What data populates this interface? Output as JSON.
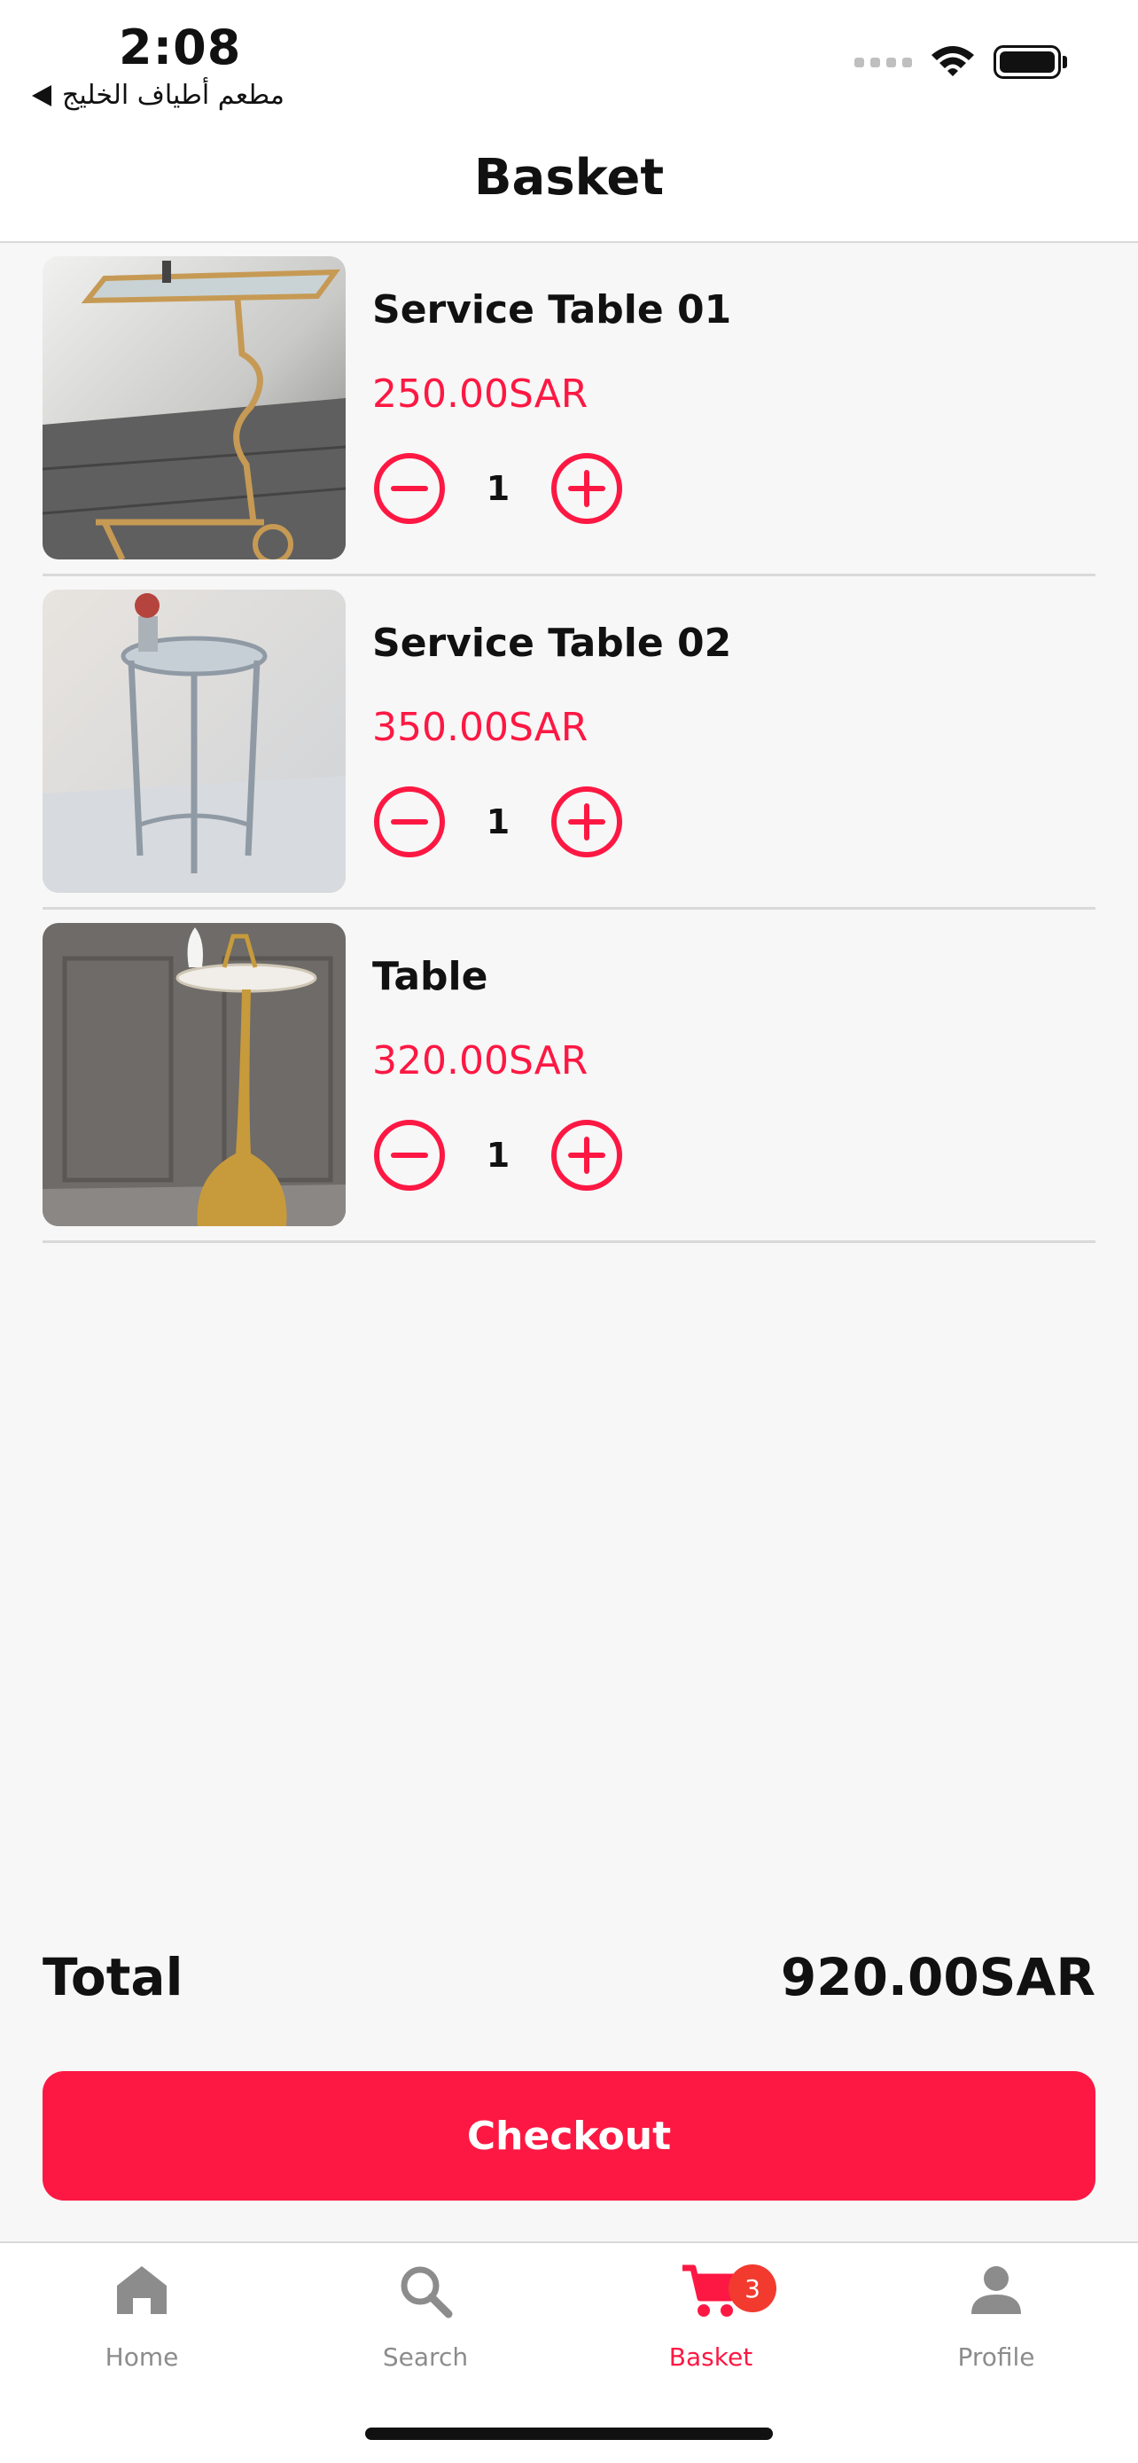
{
  "status_bar": {
    "time": "2:08",
    "back_app": "مطعم أطياف الخليج",
    "icons": [
      "signal-icon",
      "wifi-icon",
      "battery-icon"
    ]
  },
  "header": {
    "title": "Basket"
  },
  "items": [
    {
      "name": "Service Table 01",
      "price": "250.00SAR",
      "quantity": "1",
      "image": "gold-frame-side-table"
    },
    {
      "name": "Service Table 02",
      "price": "350.00SAR",
      "quantity": "1",
      "image": "silver-round-side-table"
    },
    {
      "name": "Table",
      "price": "320.00SAR",
      "quantity": "1",
      "image": "gold-pedestal-table"
    }
  ],
  "summary": {
    "total_label": "Total",
    "total_value": "920.00SAR"
  },
  "checkout": {
    "label": "Checkout"
  },
  "tabbar": {
    "tabs": [
      {
        "label": "Home",
        "icon": "home-icon",
        "active": false
      },
      {
        "label": "Search",
        "icon": "search-icon",
        "active": false
      },
      {
        "label": "Basket",
        "icon": "cart-icon",
        "active": true,
        "badge": "3"
      },
      {
        "label": "Profile",
        "icon": "person-icon",
        "active": false
      }
    ]
  },
  "colors": {
    "accent": "#fd1843",
    "inactive": "#8c8c8c",
    "badge": "#f23a2f"
  }
}
